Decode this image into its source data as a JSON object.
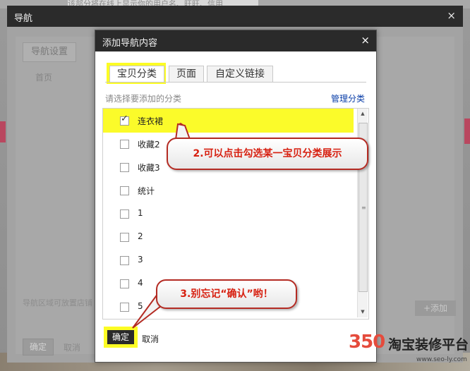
{
  "background": {
    "top_text": "该部分将在线上显示你的用户名、旺旺、信用"
  },
  "outer_dialog": {
    "title": "导航",
    "close_glyph": "×",
    "tab_label": "导航设置",
    "home_label": "首页",
    "hint_text": "导航区域可放置店铺",
    "add_button_label": "+添加",
    "ok_label": "确定",
    "cancel_label": "取消"
  },
  "inner_dialog": {
    "title": "添加导航内容",
    "close_glyph": "×",
    "tabs": [
      {
        "label": "宝贝分类",
        "active": true
      },
      {
        "label": "页面",
        "active": false
      },
      {
        "label": "自定义链接",
        "active": false
      }
    ],
    "prompt": "请选择要添加的分类",
    "manage_link": "管理分类",
    "categories": [
      {
        "label": "连衣裙",
        "checked": true
      },
      {
        "label": "收藏2",
        "checked": false
      },
      {
        "label": "收藏3",
        "checked": false
      },
      {
        "label": "统计",
        "checked": false
      },
      {
        "label": "1",
        "checked": false
      },
      {
        "label": "2",
        "checked": false
      },
      {
        "label": "3",
        "checked": false
      },
      {
        "label": "4",
        "checked": false
      },
      {
        "label": "5",
        "checked": false
      }
    ],
    "ok_label": "确定",
    "cancel_label": "取消"
  },
  "annotations": {
    "callout_1": "2.可以点击勾选某一宝贝分类展示",
    "callout_2": "3.别忘记“确认”哟！",
    "highlight_color": "#fcfc24",
    "callout_border_color": "#b42b23",
    "callout_text_color": "#d72010"
  },
  "watermark": {
    "number": "350",
    "text": "淘宝装修平台",
    "url": "www.seo-ly.com"
  }
}
